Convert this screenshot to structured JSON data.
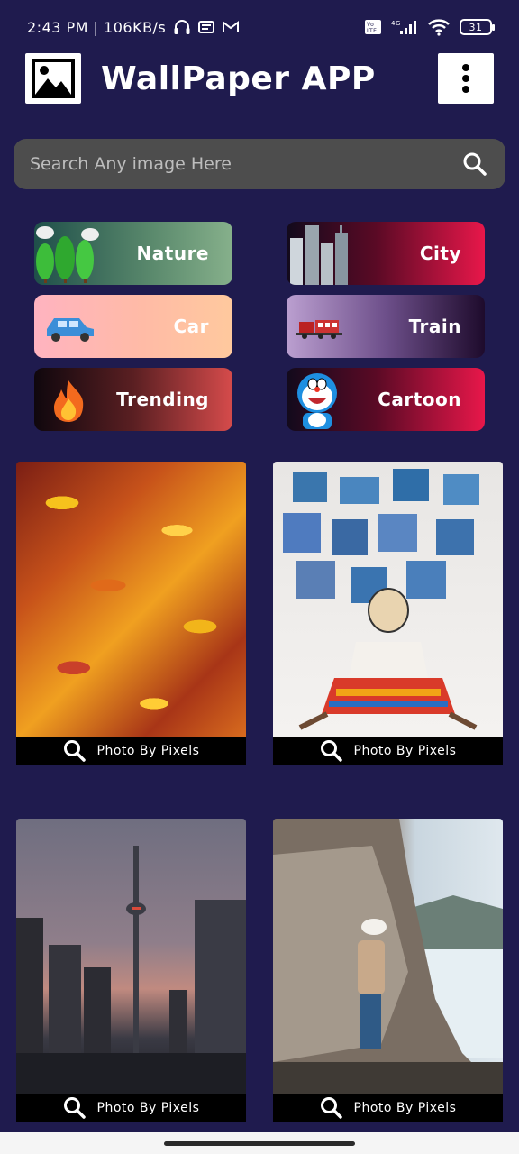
{
  "status_bar": {
    "time_speed": "2:43 PM | 106KB/s",
    "battery": "31"
  },
  "app": {
    "title": "WallPaper APP"
  },
  "search": {
    "placeholder": "Search Any image Here"
  },
  "categories": [
    {
      "label": "Nature",
      "icon": "trees-icon"
    },
    {
      "label": "City",
      "icon": "buildings-icon"
    },
    {
      "label": "Car",
      "icon": "car-icon"
    },
    {
      "label": "Train",
      "icon": "train-icon"
    },
    {
      "label": "Trending",
      "icon": "fire-icon"
    },
    {
      "label": "Cartoon",
      "icon": "doraemon-icon"
    }
  ],
  "photos": [
    {
      "subject": "autumn-leaves",
      "credit": "Photo By Pixels"
    },
    {
      "subject": "patchwork-wall-person",
      "credit": "Photo By Pixels"
    },
    {
      "subject": "cn-tower-city",
      "credit": "Photo By Pixels"
    },
    {
      "subject": "cliff-coast-person",
      "credit": "Photo By Pixels"
    }
  ],
  "colors": {
    "background": "#1f1b4e",
    "search_bg": "#4d4d4d"
  }
}
